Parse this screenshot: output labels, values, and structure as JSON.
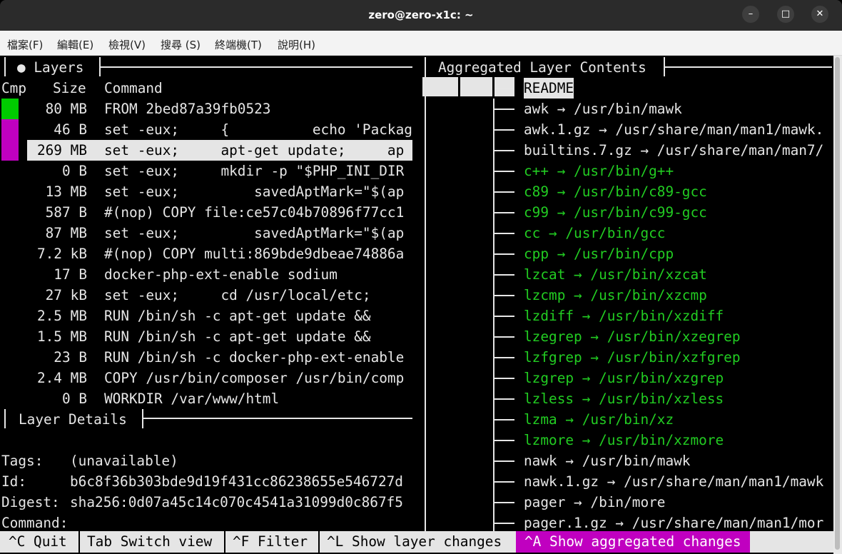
{
  "window": {
    "title": "zero@zero-x1c: ~",
    "minimize_glyph": "–",
    "maximize_glyph": "□",
    "close_glyph": "✕"
  },
  "menu": [
    "檔案(F)",
    "編輯(E)",
    "檢視(V)",
    "搜尋 (S)",
    "終端機(T)",
    "說明(H)"
  ],
  "layers_panel": {
    "title": "● Layers",
    "columns": {
      "cmp": "Cmp",
      "size": "Size",
      "command": "Command"
    },
    "rows": [
      {
        "size": "80 MB",
        "command": "FROM 2bed87a39fb0523"
      },
      {
        "size": "46 B",
        "command": "set -eux;     {          echo 'Packag"
      },
      {
        "size": "269 MB",
        "command": "set -eux;     apt-get update;     ap"
      },
      {
        "size": "0 B",
        "command": "set -eux;     mkdir -p \"$PHP_INI_DIR"
      },
      {
        "size": "13 MB",
        "command": "set -eux;         savedAptMark=\"$(ap"
      },
      {
        "size": "587 B",
        "command": "#(nop) COPY file:ce57c04b70896f77cc1"
      },
      {
        "size": "87 MB",
        "command": "set -eux;         savedAptMark=\"$(ap"
      },
      {
        "size": "7.2 kB",
        "command": "#(nop) COPY multi:869bde9dbeae74886a"
      },
      {
        "size": "17 B",
        "command": "docker-php-ext-enable sodium"
      },
      {
        "size": "27 kB",
        "command": "set -eux;     cd /usr/local/etc;"
      },
      {
        "size": "2.5 MB",
        "command": "RUN /bin/sh -c apt-get update &&"
      },
      {
        "size": "1.5 MB",
        "command": "RUN /bin/sh -c apt-get update &&"
      },
      {
        "size": "23 B",
        "command": "RUN /bin/sh -c docker-php-ext-enable"
      },
      {
        "size": "2.4 MB",
        "command": "COPY /usr/bin/composer /usr/bin/comp"
      },
      {
        "size": "0 B",
        "command": "WORKDIR /var/www/html"
      }
    ],
    "selected_index": 2,
    "cmp_colors": {
      "added": "#00cc00",
      "modified": "#c000c0"
    }
  },
  "details_panel": {
    "title": "Layer Details",
    "tags_label": "Tags:",
    "tags_value": "(unavailable)",
    "id_label": "Id:",
    "id_value": "b6c8f36b303bde9d19f431cc86238655e546727d",
    "digest_label": "Digest:",
    "digest_value": "sha256:0d07a45c14c070c4541a31099d0c867f5",
    "command_label": "Command:"
  },
  "contents_panel": {
    "title": "Aggregated Layer Contents",
    "entries": [
      {
        "name": "README",
        "highlight": true
      },
      {
        "name": "awk → /usr/bin/mawk"
      },
      {
        "name": "awk.1.gz → /usr/share/man/man1/mawk."
      },
      {
        "name": "builtins.7.gz → /usr/share/man/man7/"
      },
      {
        "name": "c++ → /usr/bin/g++",
        "green": true
      },
      {
        "name": "c89 → /usr/bin/c89-gcc",
        "green": true
      },
      {
        "name": "c99 → /usr/bin/c99-gcc",
        "green": true
      },
      {
        "name": "cc → /usr/bin/gcc",
        "green": true
      },
      {
        "name": "cpp → /usr/bin/cpp",
        "green": true
      },
      {
        "name": "lzcat → /usr/bin/xzcat",
        "green": true
      },
      {
        "name": "lzcmp → /usr/bin/xzcmp",
        "green": true
      },
      {
        "name": "lzdiff → /usr/bin/xzdiff",
        "green": true
      },
      {
        "name": "lzegrep → /usr/bin/xzegrep",
        "green": true
      },
      {
        "name": "lzfgrep → /usr/bin/xzfgrep",
        "green": true
      },
      {
        "name": "lzgrep → /usr/bin/xzgrep",
        "green": true
      },
      {
        "name": "lzless → /usr/bin/xzless",
        "green": true
      },
      {
        "name": "lzma → /usr/bin/xz",
        "green": true
      },
      {
        "name": "lzmore → /usr/bin/xzmore",
        "green": true
      },
      {
        "name": "nawk → /usr/bin/mawk"
      },
      {
        "name": "nawk.1.gz → /usr/share/man/man1/mawk"
      },
      {
        "name": "pager → /bin/more"
      },
      {
        "name": "pager.1.gz → /usr/share/man/man1/mor"
      }
    ],
    "added_color": "#22cc22"
  },
  "keybar": {
    "quit": "^C Quit",
    "switch": "Tab Switch view",
    "filter": "^F Filter",
    "layer_changes": "^L Show layer changes",
    "aggregated": "^A Show aggregated changes",
    "active_color": "#c000c0"
  }
}
